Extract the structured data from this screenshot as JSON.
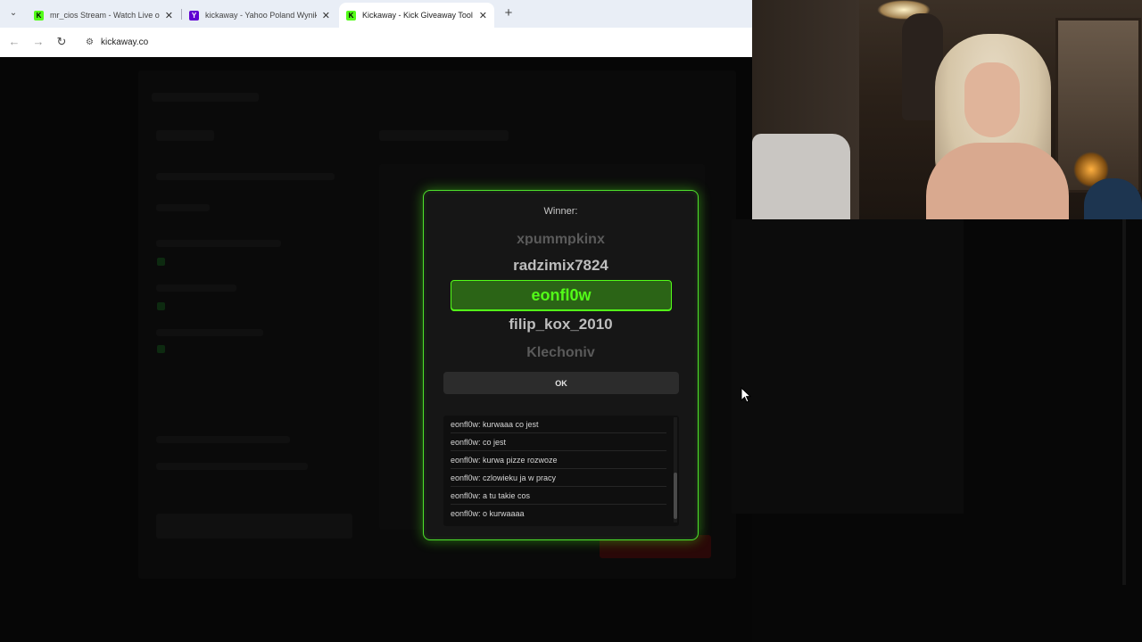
{
  "browser": {
    "tabs": [
      {
        "title": "mr_cios Stream - Watch Live on Kick",
        "favicon": "kick-logo",
        "favicon_color": "#53fc18",
        "active": false
      },
      {
        "title": "kickaway - Yahoo Poland Wyniki",
        "favicon": "yahoo-logo",
        "favicon_color": "#6001d2",
        "active": false
      },
      {
        "title": "Kickaway - Kick Giveaway Tool",
        "favicon": "kickaway-logo",
        "favicon_color": "#53fc18",
        "active": true
      }
    ],
    "address": "kickaway.co"
  },
  "modal": {
    "winner_label": "Winner:",
    "reel": {
      "top_far": "xpummpkinx",
      "top_near": "radzimix7824",
      "selected": "eonfl0w",
      "bottom_near": "filip_kox_2010",
      "bottom_far": "Klechoniv"
    },
    "ok_label": "OK",
    "chat_messages": [
      "eonfl0w: kurwaaa co jest",
      "eonfl0w: co jest",
      "eonfl0w: kurwa pizze rozwoze",
      "eonfl0w: czlowieku ja w pracy",
      "eonfl0w: a tu takie cos",
      "eonfl0w: o kurwaaaa"
    ]
  },
  "colors": {
    "accent": "#53fc18",
    "selected_bg": "#2b6416",
    "modal_bg": "#161616"
  }
}
